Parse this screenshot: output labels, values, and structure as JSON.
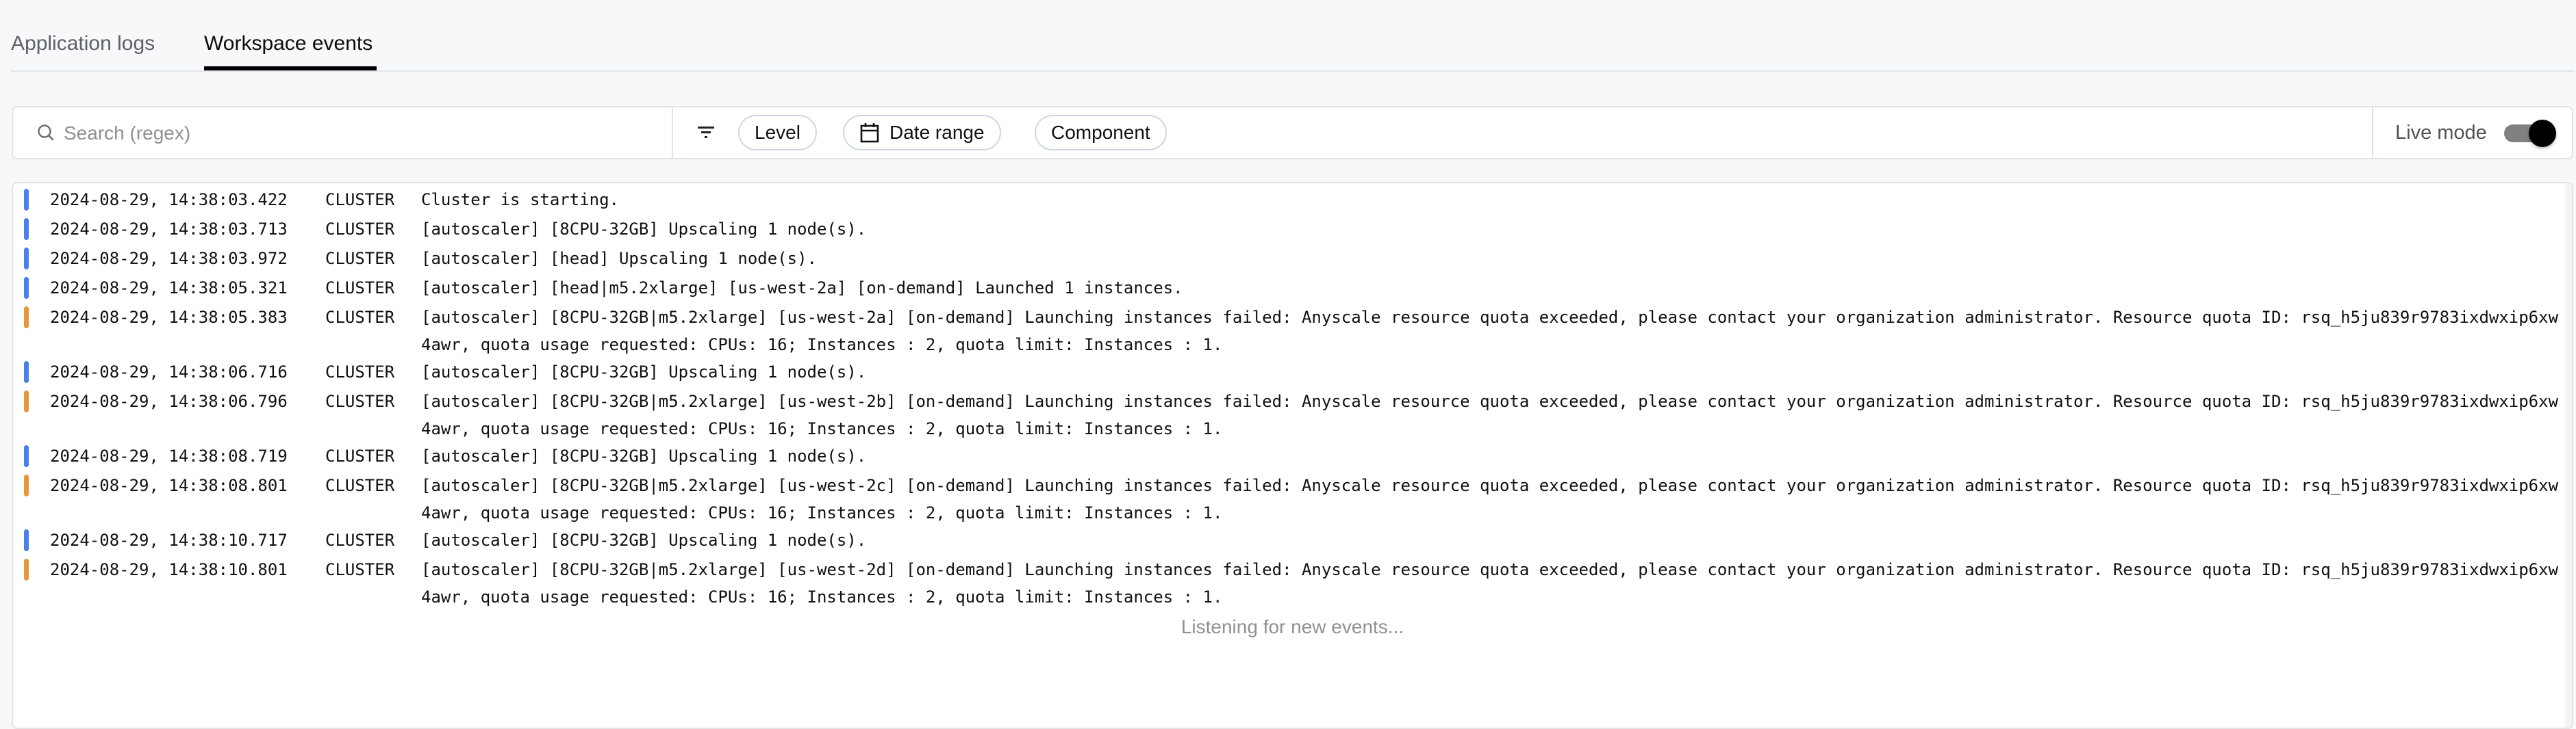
{
  "tabs": [
    {
      "label": "Application logs",
      "active": false
    },
    {
      "label": "Workspace events",
      "active": true
    }
  ],
  "toolbar": {
    "search": {
      "placeholder": "Search (regex)",
      "value": "",
      "icon": "search-icon"
    },
    "filter_icon": "filter-icon",
    "filters": [
      {
        "label": "Level"
      },
      {
        "label": "Date range",
        "icon": "calendar-icon"
      },
      {
        "label": "Component"
      }
    ],
    "live_mode": {
      "label": "Live mode",
      "enabled": true
    }
  },
  "colors": {
    "info": "#4a7fea",
    "warning": "#e8963a"
  },
  "log": {
    "entries": [
      {
        "level": "info",
        "timestamp": "2024-08-29, 14:38:03.422",
        "component": "CLUSTER",
        "message": "Cluster is starting."
      },
      {
        "level": "info",
        "timestamp": "2024-08-29, 14:38:03.713",
        "component": "CLUSTER",
        "message": "[autoscaler] [8CPU-32GB] Upscaling 1 node(s)."
      },
      {
        "level": "info",
        "timestamp": "2024-08-29, 14:38:03.972",
        "component": "CLUSTER",
        "message": "[autoscaler] [head] Upscaling 1 node(s)."
      },
      {
        "level": "info",
        "timestamp": "2024-08-29, 14:38:05.321",
        "component": "CLUSTER",
        "message": "[autoscaler] [head|m5.2xlarge] [us-west-2a] [on-demand] Launched 1 instances."
      },
      {
        "level": "warning",
        "timestamp": "2024-08-29, 14:38:05.383",
        "component": "CLUSTER",
        "message": "[autoscaler] [8CPU-32GB|m5.2xlarge] [us-west-2a] [on-demand] Launching instances failed: Anyscale resource quota exceeded, please contact your organization administrator. Resource quota ID: rsq_h5ju839r9783ixdwxip6xw4awr, quota usage requested: CPUs: 16; Instances : 2, quota limit: Instances : 1."
      },
      {
        "level": "info",
        "timestamp": "2024-08-29, 14:38:06.716",
        "component": "CLUSTER",
        "message": "[autoscaler] [8CPU-32GB] Upscaling 1 node(s)."
      },
      {
        "level": "warning",
        "timestamp": "2024-08-29, 14:38:06.796",
        "component": "CLUSTER",
        "message": "[autoscaler] [8CPU-32GB|m5.2xlarge] [us-west-2b] [on-demand] Launching instances failed: Anyscale resource quota exceeded, please contact your organization administrator. Resource quota ID: rsq_h5ju839r9783ixdwxip6xw4awr, quota usage requested: CPUs: 16; Instances : 2, quota limit: Instances : 1."
      },
      {
        "level": "info",
        "timestamp": "2024-08-29, 14:38:08.719",
        "component": "CLUSTER",
        "message": "[autoscaler] [8CPU-32GB] Upscaling 1 node(s)."
      },
      {
        "level": "warning",
        "timestamp": "2024-08-29, 14:38:08.801",
        "component": "CLUSTER",
        "message": "[autoscaler] [8CPU-32GB|m5.2xlarge] [us-west-2c] [on-demand] Launching instances failed: Anyscale resource quota exceeded, please contact your organization administrator. Resource quota ID: rsq_h5ju839r9783ixdwxip6xw4awr, quota usage requested: CPUs: 16; Instances : 2, quota limit: Instances : 1."
      },
      {
        "level": "info",
        "timestamp": "2024-08-29, 14:38:10.717",
        "component": "CLUSTER",
        "message": "[autoscaler] [8CPU-32GB] Upscaling 1 node(s)."
      },
      {
        "level": "warning",
        "timestamp": "2024-08-29, 14:38:10.801",
        "component": "CLUSTER",
        "message": "[autoscaler] [8CPU-32GB|m5.2xlarge] [us-west-2d] [on-demand] Launching instances failed: Anyscale resource quota exceeded, please contact your organization administrator. Resource quota ID: rsq_h5ju839r9783ixdwxip6xw4awr, quota usage requested: CPUs: 16; Instances : 2, quota limit: Instances : 1."
      }
    ],
    "status": "Listening for new events..."
  }
}
